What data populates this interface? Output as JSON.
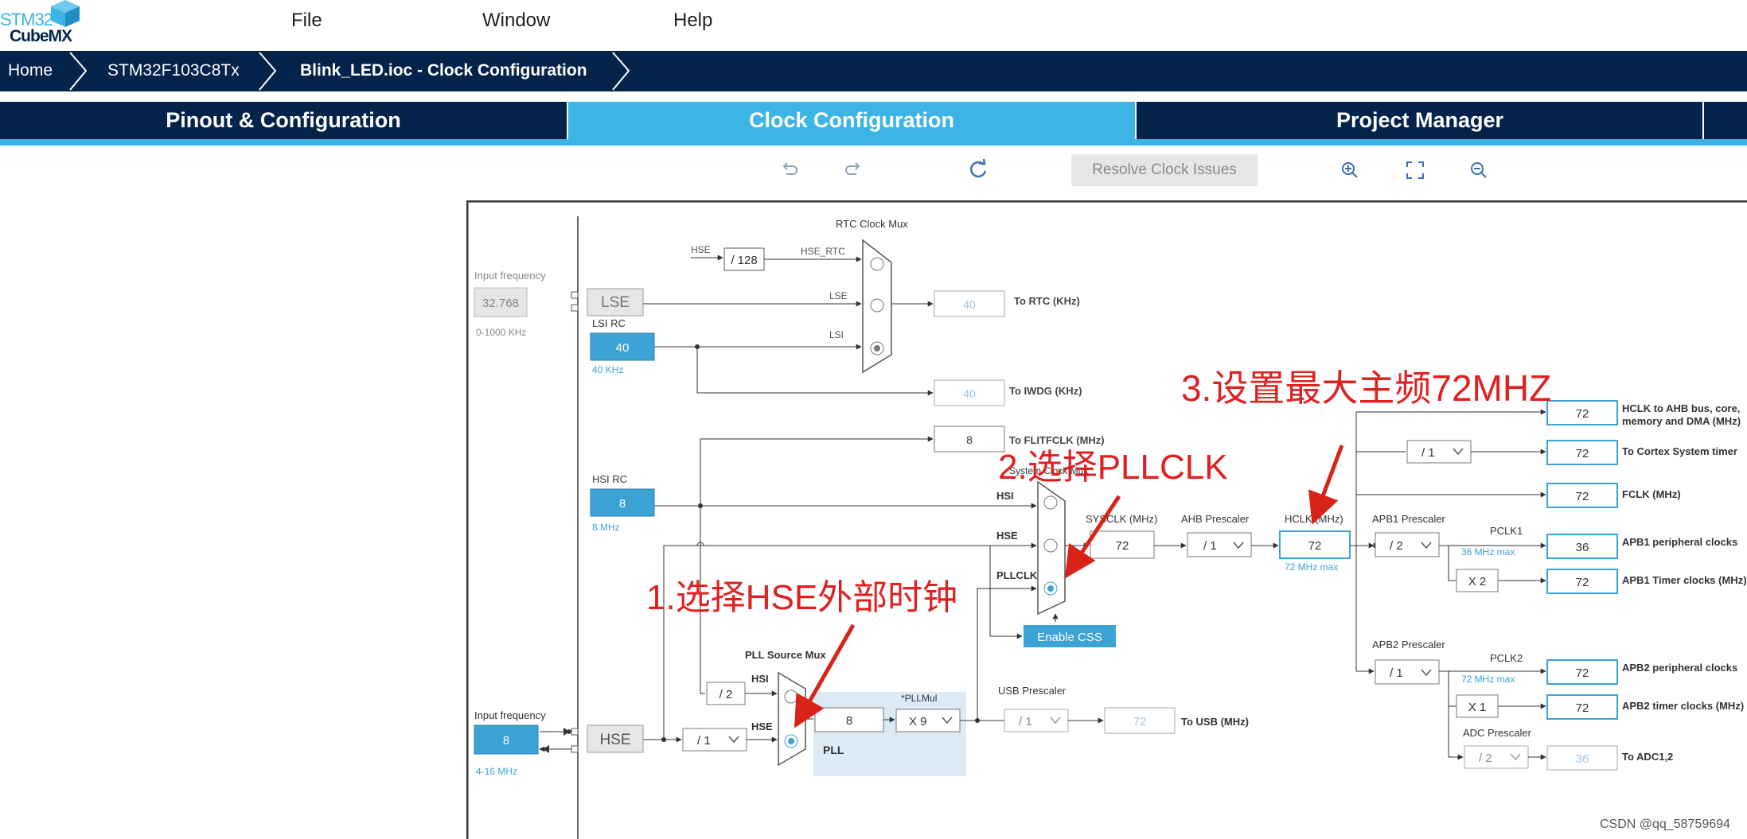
{
  "app": {
    "logo_line1": "STM32",
    "logo_line2": "CubeMX"
  },
  "menu": {
    "file": "File",
    "window": "Window",
    "help": "Help"
  },
  "breadcrumb": {
    "home": "Home",
    "device": "STM32F103C8Tx",
    "file": "Blink_LED.ioc - Clock Configuration"
  },
  "tabs": {
    "pinout": "Pinout & Configuration",
    "clock": "Clock Configuration",
    "project": "Project Manager"
  },
  "toolbar": {
    "resolve": "Resolve Clock Issues"
  },
  "diagram": {
    "rtc_mux_title": "RTC Clock Mux",
    "input_freq_label": "Input frequency",
    "lse_input_value": "32.768",
    "lse_range": "0-1000 KHz",
    "lse": "LSE",
    "lsi_rc": "LSI RC",
    "lsi_value": "40",
    "lsi_khz": "40 KHz",
    "hse_label": "HSE",
    "div128": "/ 128",
    "hse_rtc": "HSE_RTC",
    "lse_sig": "LSE",
    "lsi_sig": "LSI",
    "rtc_value": "40",
    "to_rtc": "To RTC (KHz)",
    "iwdg_value": "40",
    "to_iwdg": "To IWDG (KHz)",
    "flit_value": "8",
    "to_flit": "To FLITFCLK (MHz)",
    "hsi_rc": "HSI RC",
    "hsi_value": "8",
    "hsi_mhz": "8 MHz",
    "sys_mux_title": "System Clock Mux",
    "sys_hsi": "HSI",
    "sys_hse": "HSE",
    "sys_pllclk": "PLLCLK",
    "sysclk_label": "SYSCLK (MHz)",
    "sysclk_value": "72",
    "ahb_prescaler": "AHB Prescaler",
    "ahb_div": "/ 1",
    "hclk_label": "HCLK (MHz)",
    "hclk_value": "72",
    "hclk_max": "72 MHz max",
    "enable_css": "Enable CSS",
    "pll_src_mux": "PLL Source Mux",
    "pll_hsi": "HSI",
    "pll_hse": "HSE",
    "div2": "/ 2",
    "pll_value": "8",
    "pll_mul_label": "*PLLMul",
    "pll_mul": "X 9",
    "pll": "PLL",
    "usb_prescaler": "USB Prescaler",
    "usb_div": "/ 1",
    "usb_value": "72",
    "to_usb": "To USB (MHz)",
    "hse_input_label": "Input frequency",
    "hse_value": "8",
    "hse_range": "4-16 MHz",
    "hse_block": "HSE",
    "hse_div": "/ 1",
    "apb1_prescaler": "APB1 Prescaler",
    "apb1_div": "/ 2",
    "pclk1": "PCLK1",
    "pclk1_max": "36 MHz max",
    "x2": "X 2",
    "apb2_prescaler": "APB2 Prescaler",
    "apb2_div": "/ 1",
    "pclk2": "PCLK2",
    "pclk2_max": "72 MHz max",
    "x1": "X 1",
    "adc_prescaler": "ADC Prescaler",
    "adc_div": "/ 2",
    "cortex_div": "/ 1",
    "out_ahb_value": "72",
    "out_ahb_label": "HCLK to AHB bus, core,",
    "out_ahb_label2": "memory and DMA (MHz)",
    "out_cortex_value": "72",
    "out_cortex_label": "To Cortex System timer",
    "out_fclk_value": "72",
    "out_fclk_label": "FCLK (MHz)",
    "out_apb1p_value": "36",
    "out_apb1p_label": "APB1 peripheral clocks",
    "out_apb1t_value": "72",
    "out_apb1t_label": "APB1 Timer clocks (MHz)",
    "out_apb2p_value": "72",
    "out_apb2p_label": "APB2 peripheral clocks",
    "out_apb2t_value": "72",
    "out_apb2t_label": "APB2 timer clocks (MHz)",
    "out_adc_value": "36",
    "out_adc_label": "To ADC1,2"
  },
  "annotations": {
    "step1": "1.选择HSE外部时钟",
    "step2": "2.选择PLLCLK",
    "step3": "3.设置最大主频72MHZ"
  },
  "watermark": "CSDN @qq_58759694",
  "colors": {
    "navy": "#03234b",
    "accent": "#3cb4e6",
    "annotation": "#e02020"
  }
}
